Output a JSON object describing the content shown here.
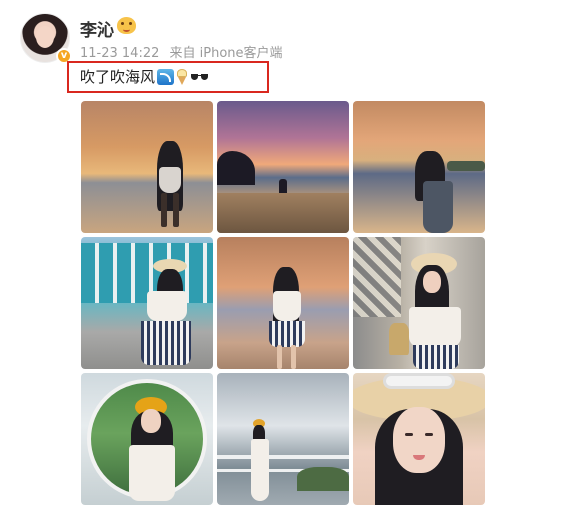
{
  "post": {
    "author": {
      "name": "李沁",
      "avatar": "avatar-icon",
      "verified_icon": "verified-badge-icon",
      "name_badge": "emoji-badge-icon"
    },
    "meta": {
      "timestamp": "11-23 14:22",
      "source": "来自 iPhone客户端"
    },
    "text": "吹了吹海风",
    "emojis": [
      "wave-emoji-icon",
      "ice-cream-emoji-icon",
      "sunglasses-emoji-icon"
    ],
    "highlight_color": "#d9281f",
    "photos": [
      {
        "name": "photo-sunset-beach-1",
        "desc_icon": "photo-icon"
      },
      {
        "name": "photo-sunset-beach-2",
        "desc_icon": "photo-icon"
      },
      {
        "name": "photo-sunset-beach-3",
        "desc_icon": "photo-icon"
      },
      {
        "name": "photo-building",
        "desc_icon": "photo-icon"
      },
      {
        "name": "photo-seaside-standing",
        "desc_icon": "photo-icon"
      },
      {
        "name": "photo-hat-window",
        "desc_icon": "photo-icon"
      },
      {
        "name": "photo-mirror",
        "desc_icon": "photo-icon"
      },
      {
        "name": "photo-railing",
        "desc_icon": "photo-icon"
      },
      {
        "name": "photo-selfie-hat",
        "desc_icon": "photo-icon"
      }
    ]
  }
}
